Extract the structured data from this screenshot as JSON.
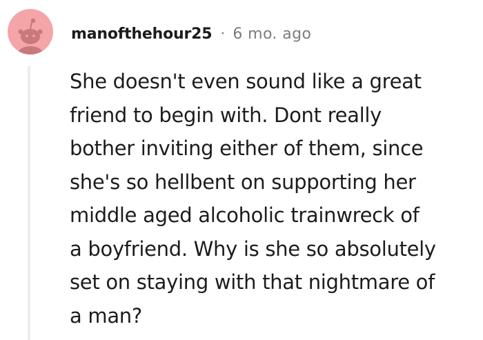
{
  "comment": {
    "username": "manofthehour25",
    "separator": "·",
    "timestamp": "6 mo. ago",
    "avatar_icon": "reddit-snoo-avatar-icon",
    "avatar_color": "#f4a5a8",
    "body": "She doesn't even sound like a great\nfriend to begin with. Dont really\nbother inviting either of them, since\nshe's so hellbent on supporting her\nmiddle aged alcoholic trainwreck of\na boyfriend. Why is she so absolutely\nset on staying with that nightmare of\na man?"
  }
}
